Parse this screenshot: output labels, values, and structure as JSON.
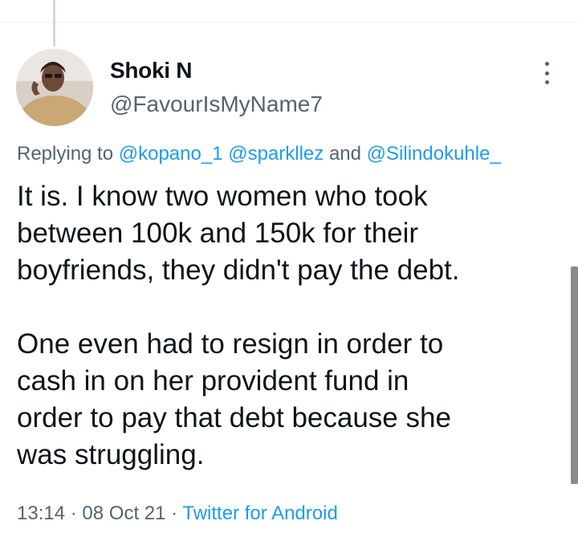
{
  "tweet": {
    "display_name": "Shoki N",
    "handle": "@FavourIsMyName7",
    "replying_prefix": "Replying to",
    "mentions": [
      "@kopano_1",
      "@sparkllez",
      "@Silindokuhle_"
    ],
    "mention_joiner": "and",
    "paragraphs": [
      [
        "It is. I know two women who took",
        "between 100k and 150k for their",
        "boyfriends,  they didn't pay the debt."
      ],
      [
        "One even had to resign in order to",
        "cash in on her provident fund in",
        "order to pay that debt because she",
        "was struggling."
      ]
    ],
    "time": "13:14",
    "date": "08 Oct 21",
    "separator": "·",
    "source": "Twitter for Android"
  },
  "icons": {
    "more": "more-vertical-icon"
  },
  "colors": {
    "text": "#0f1419",
    "secondary": "#536471",
    "link": "#1d9bf0"
  }
}
